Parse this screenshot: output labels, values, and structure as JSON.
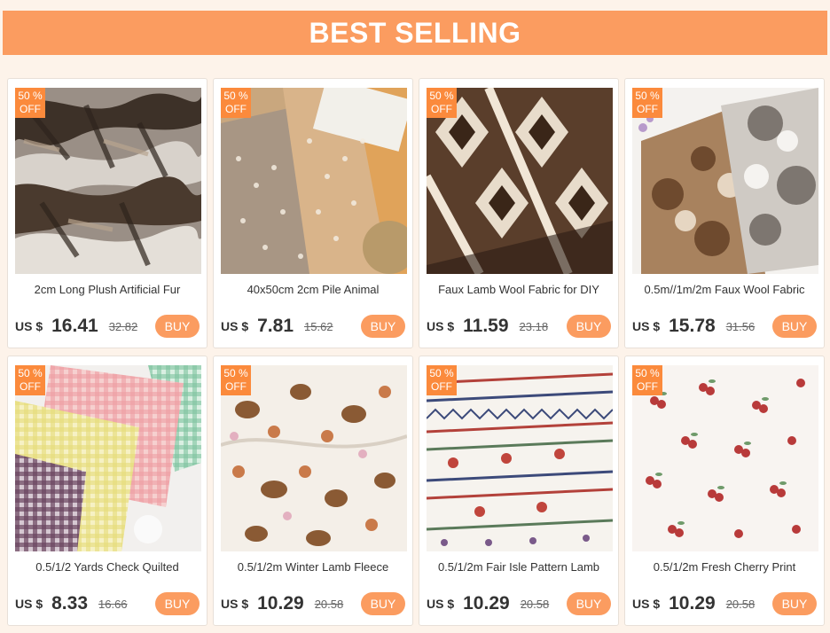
{
  "banner": {
    "title": "BEST SELLING"
  },
  "colors": {
    "accent": "#fb9c60",
    "badge": "#fb8a3c",
    "background": "#fdf3ea"
  },
  "products": [
    {
      "badge_line1": "50 %",
      "badge_line2": "OFF",
      "title": "2cm Long Plush Artificial Fur",
      "currency": "US $",
      "price": "16.41",
      "old_price": "32.82",
      "buy_label": "BUY",
      "image": "tiger-stripe-faux-fur"
    },
    {
      "badge_line1": "50 %",
      "badge_line2": "OFF",
      "title": "40x50cm 2cm Pile Animal",
      "currency": "US $",
      "price": "7.81",
      "old_price": "15.62",
      "buy_label": "BUY",
      "image": "deer-spot-plush"
    },
    {
      "badge_line1": "50 %",
      "badge_line2": "OFF",
      "title": "Faux Lamb Wool Fabric for DIY",
      "currency": "US $",
      "price": "11.59",
      "old_price": "23.18",
      "buy_label": "BUY",
      "image": "argyle-lamb-wool"
    },
    {
      "badge_line1": "50 %",
      "badge_line2": "OFF",
      "title": "0.5m//1m/2m Faux Wool Fabric",
      "currency": "US $",
      "price": "15.78",
      "old_price": "31.56",
      "buy_label": "BUY",
      "image": "camouflage-sherpa"
    },
    {
      "badge_line1": "50 %",
      "badge_line2": "OFF",
      "title": "0.5/1/2 Yards Check Quilted",
      "currency": "US $",
      "price": "8.33",
      "old_price": "16.66",
      "buy_label": "BUY",
      "image": "gingham-quilted"
    },
    {
      "badge_line1": "50 %",
      "badge_line2": "OFF",
      "title": "0.5/1/2m Winter Lamb Fleece",
      "currency": "US $",
      "price": "10.29",
      "old_price": "20.58",
      "buy_label": "BUY",
      "image": "bakery-print-fleece"
    },
    {
      "badge_line1": "50 %",
      "badge_line2": "OFF",
      "title": "0.5/1/2m Fair Isle Pattern Lamb",
      "currency": "US $",
      "price": "10.29",
      "old_price": "20.58",
      "buy_label": "BUY",
      "image": "fair-isle-fleece"
    },
    {
      "badge_line1": "50 %",
      "badge_line2": "OFF",
      "title": "0.5/1/2m Fresh Cherry Print",
      "currency": "US $",
      "price": "10.29",
      "old_price": "20.58",
      "buy_label": "BUY",
      "image": "cherry-print-fleece"
    }
  ]
}
